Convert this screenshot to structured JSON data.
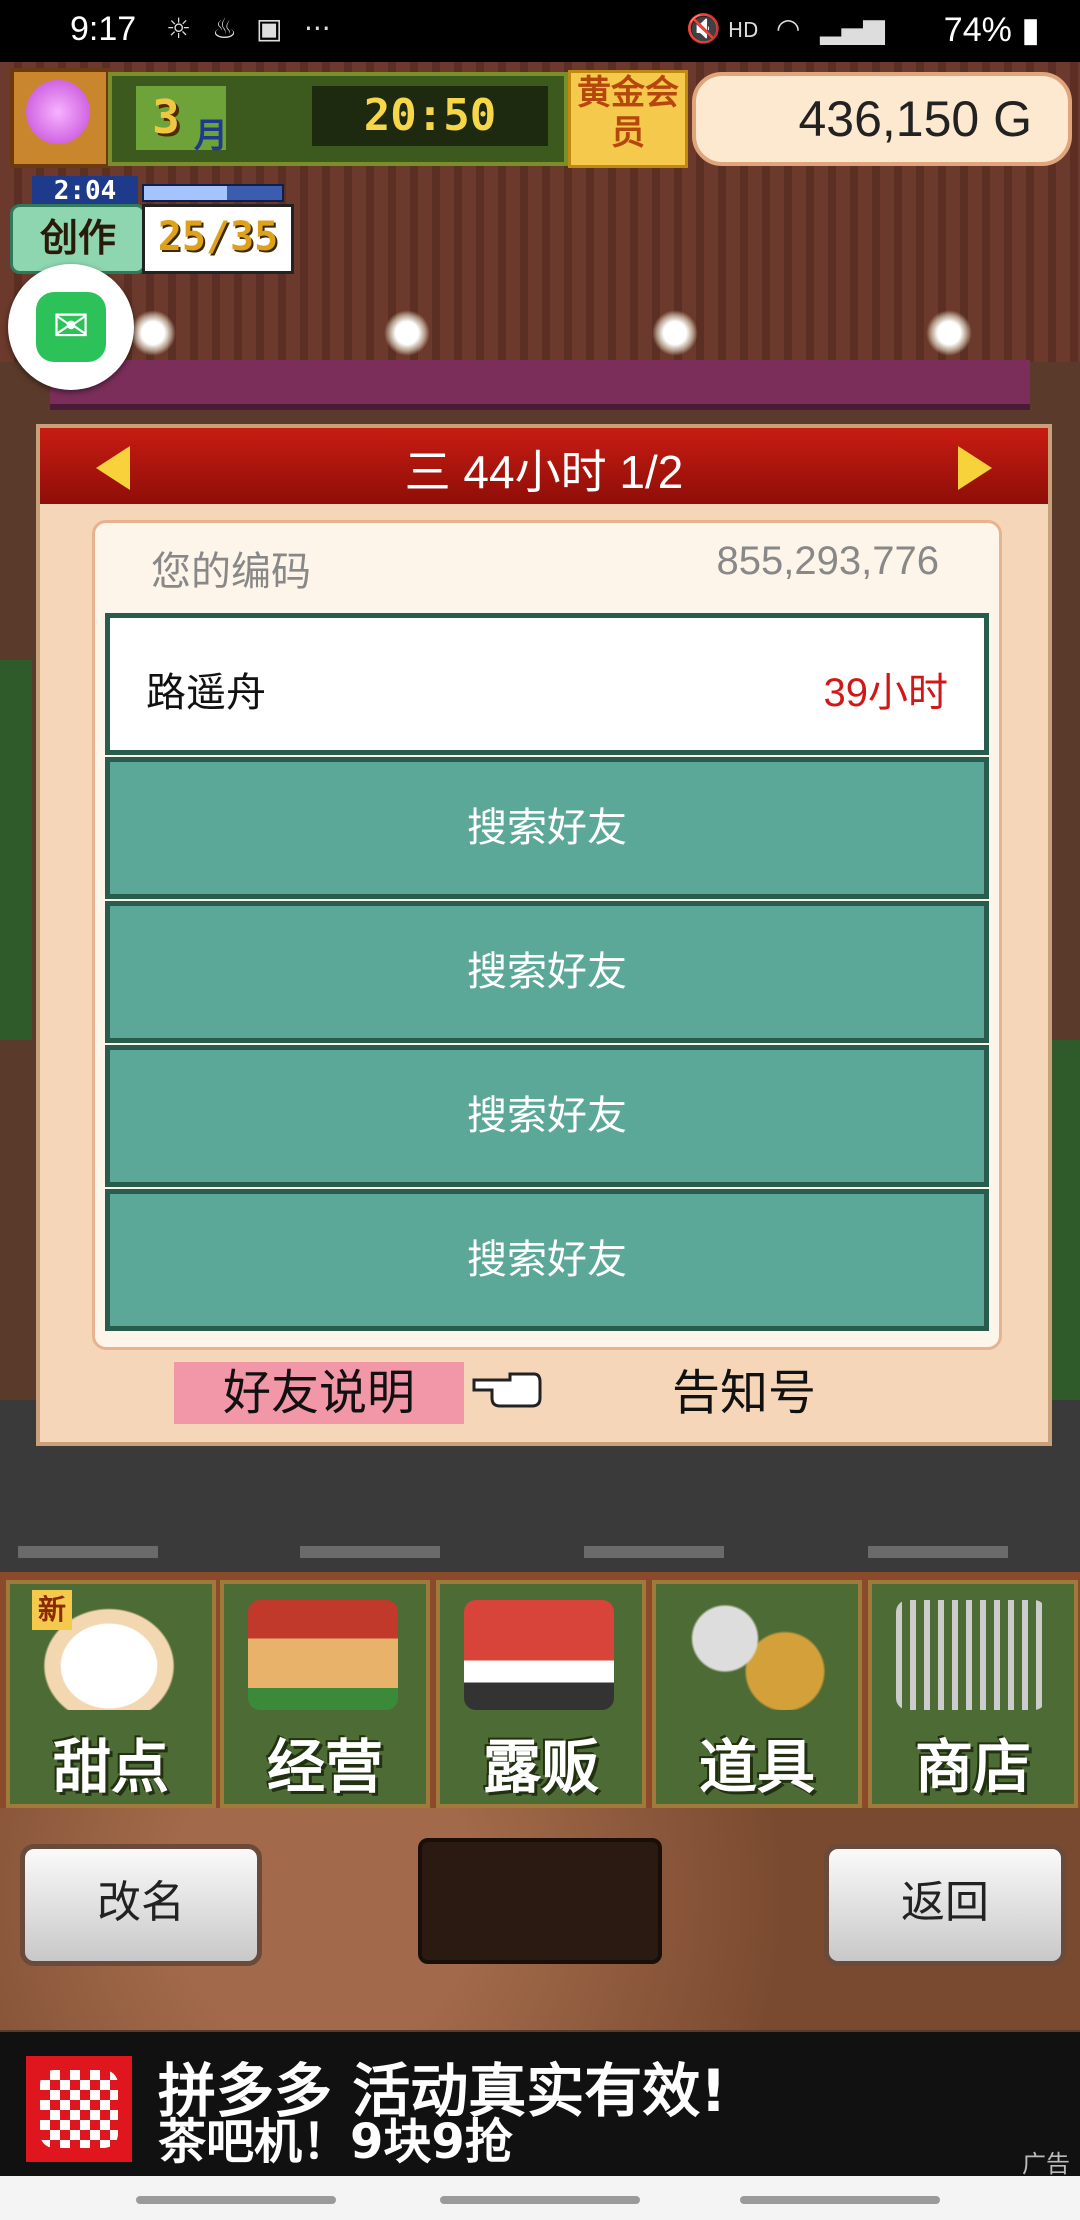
{
  "status_bar": {
    "time": "9:17",
    "icons": [
      "weather-icon",
      "notification-icon",
      "shopping-bag-icon",
      "more-icon"
    ],
    "right_icons": [
      "mute-icon",
      "hd-icon",
      "wifi-icon",
      "signal-icon"
    ],
    "hd": "HD",
    "battery": "74%"
  },
  "hud": {
    "month_number": "3",
    "month_label": "月",
    "clock": "20:50",
    "gold_member": "黄金会员",
    "money": "436,150 G",
    "create_timer": "2:04",
    "create_label": "创作",
    "create_count": "25/35"
  },
  "dialog": {
    "title": "三  44小时 1/2",
    "code_label": "您的编码",
    "code_value": "855,293,776",
    "friend": {
      "name": "路遥舟",
      "hours": "39小时"
    },
    "search_rows": [
      "搜索好友",
      "搜索好友",
      "搜索好友",
      "搜索好友"
    ],
    "help_button": "好友说明",
    "notice_button": "告知号"
  },
  "menu": {
    "new_tag": "新",
    "items": [
      {
        "label": "甜点",
        "icon": "cake-icon"
      },
      {
        "label": "经营",
        "icon": "shop-icon"
      },
      {
        "label": "露贩",
        "icon": "food-truck-icon"
      },
      {
        "label": "道具",
        "icon": "items-bag-icon"
      },
      {
        "label": "商店",
        "icon": "shopping-cart-icon"
      }
    ]
  },
  "bottom": {
    "rename": "改名",
    "back": "返回"
  },
  "ad": {
    "line1": "拼多多  活动真实有效!",
    "line2": "茶吧机！9块9抢",
    "tag": "广告"
  },
  "colors": {
    "dialog_header": "#c81c12",
    "search_row": "#5ba898",
    "friend_hours": "#d01818",
    "help_button": "#f297a8"
  }
}
